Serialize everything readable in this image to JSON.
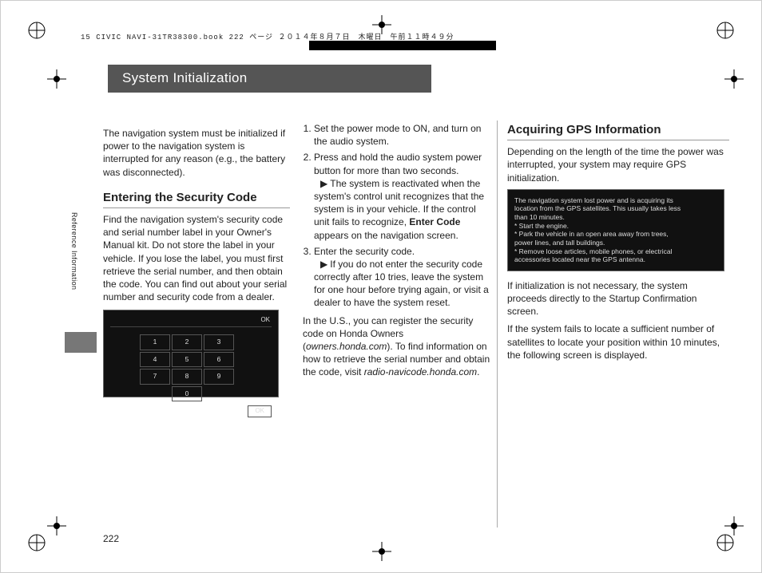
{
  "header_line": "15 CIVIC NAVI-31TR38300.book  222 ページ  ２０１４年８月７日　木曜日　午前１１時４９分",
  "title": "System Initialization",
  "side_tab": "Reference Information",
  "page_number": "222",
  "col1": {
    "intro": "The navigation system must be initialized if power to the navigation system is interrupted for any reason (e.g., the battery was disconnected).",
    "h": "Entering the Security Code",
    "p": "Find the navigation system's security code and serial number label in your Owner's Manual kit. Do not store the label in your vehicle. If you lose the label, you must first retrieve the serial number, and then obtain the code. You can find out about your serial number and security code from a dealer.",
    "kp_ok": "OK",
    "kp": [
      "1",
      "2",
      "3",
      "4",
      "5",
      "6",
      "7",
      "8",
      "9",
      "0"
    ]
  },
  "col2": {
    "s1": "Set the power mode to ON, and turn on the audio system.",
    "s2": "Press and hold the audio system power button for more than two seconds.",
    "s2a_a": "The system is reactivated when the system's control unit recognizes that the system is in your vehicle. If the control unit fails to recognize, ",
    "s2a_b": "Enter Code",
    "s2a_c": " appears on the navigation screen.",
    "s3": "Enter the security code.",
    "s3a": "If you do not enter the security code correctly after 10 tries, leave the system for one hour before trying again, or visit a dealer to have the system reset.",
    "p2_a": "In the U.S., you can register the security code on Honda Owners (",
    "p2_b": "owners.honda.com",
    "p2_c": "). To find information on how to retrieve the serial number and obtain the code, visit ",
    "p2_d": "radio-navicode.honda.com",
    "p2_e": "."
  },
  "col3": {
    "h": "Acquiring GPS Information",
    "p1": "Depending on the length of the time the power was interrupted, your system may require GPS initialization.",
    "gps_l1": "The navigation system lost power and is acquiring its",
    "gps_l2": "location from the GPS satellites. This usually takes less",
    "gps_l3": "than 10 minutes.",
    "gps_l4": "* Start the engine.",
    "gps_l5": "* Park the vehicle in an open area away from trees,",
    "gps_l6": "power lines, and tall buildings.",
    "gps_l7": "* Remove loose articles, mobile phones, or electrical",
    "gps_l8": "accessories located near the GPS antenna.",
    "p2": "If initialization is not necessary, the system proceeds directly to the Startup Confirmation screen.",
    "p3": "If the system fails to locate a sufficient number of satellites to locate your position within 10 minutes, the following screen is displayed."
  }
}
